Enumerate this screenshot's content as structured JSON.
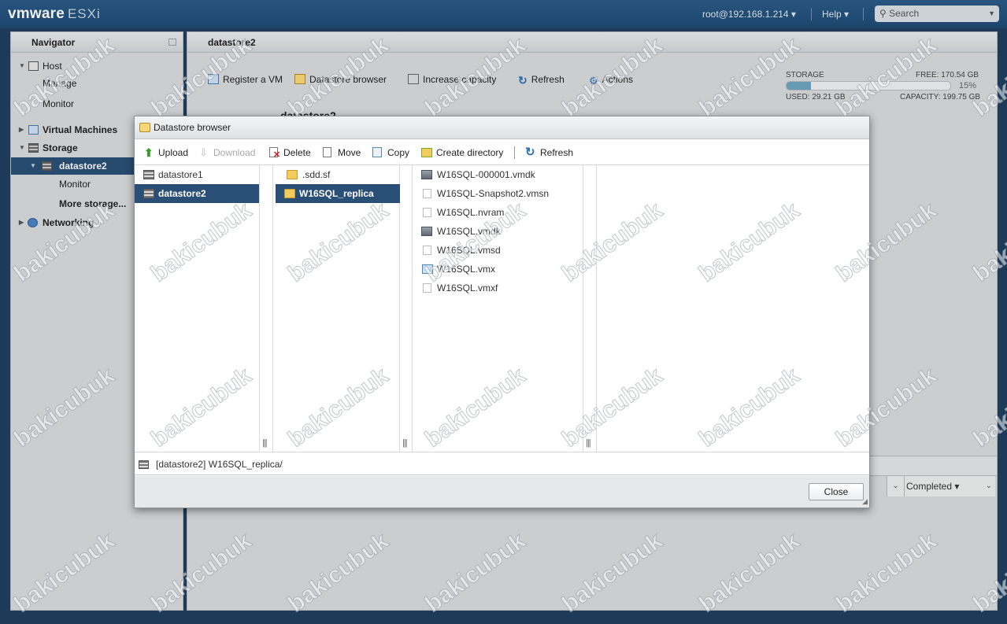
{
  "topbar": {
    "logo_brand": "vmware",
    "logo_product": "ESXi",
    "user": "root@192.168.1.214 ▾",
    "help": "Help ▾",
    "search_placeholder": "Search",
    "search_caret": "▼"
  },
  "navigator": {
    "title": "Navigator",
    "items": [
      {
        "label": "Host",
        "tri": "▼"
      },
      {
        "label": "Manage"
      },
      {
        "label": "Monitor"
      },
      {
        "label": "Virtual Machines",
        "tri": "▶"
      },
      {
        "label": "Storage",
        "tri": "▼"
      },
      {
        "label": "datastore2",
        "tri": "▼"
      },
      {
        "label": "Monitor"
      },
      {
        "label": "More storage..."
      },
      {
        "label": "Networking",
        "tri": "▶"
      }
    ]
  },
  "main": {
    "title": "datastore2",
    "toolbar": {
      "register_vm": "Register a VM",
      "datastore_browser": "Datastore browser",
      "increase_capacity": "Increase capacity",
      "refresh": "Refresh",
      "actions": "Actions"
    },
    "storage": {
      "label": "STORAGE",
      "free": "FREE: 170.54 GB",
      "percent": "15%",
      "used_fraction": 0.15,
      "used": "USED: 29.21 GB",
      "capacity": "CAPACITY: 199.75 GB"
    },
    "heading": "datastore2",
    "tasks_filter": "Completed ▾",
    "tasks_chevron": "⌄"
  },
  "dialog": {
    "title": "Datastore browser",
    "toolbar": {
      "upload": "Upload",
      "download": "Download",
      "delete": "Delete",
      "move": "Move",
      "copy": "Copy",
      "create_directory": "Create directory",
      "refresh": "Refresh"
    },
    "datastores": [
      "datastore1",
      "datastore2"
    ],
    "folders": [
      ".sdd.sf",
      "W16SQL_replica"
    ],
    "files": [
      {
        "name": "W16SQL-000001.vmdk",
        "icon": "disk-icon"
      },
      {
        "name": "W16SQL-Snapshot2.vmsn",
        "icon": "file-icon"
      },
      {
        "name": "W16SQL.nvram",
        "icon": "file-icon"
      },
      {
        "name": "W16SQL.vmdk",
        "icon": "disk-icon"
      },
      {
        "name": "W16SQL.vmsd",
        "icon": "file-icon"
      },
      {
        "name": "W16SQL.vmx",
        "icon": "vmx-icon"
      },
      {
        "name": "W16SQL.vmxf",
        "icon": "file-icon"
      }
    ],
    "grip": "|||",
    "path": "[datastore2] W16SQL_replica/",
    "close": "Close",
    "resize_glyph": "◢"
  },
  "watermark": "bakicubuk",
  "colors": {
    "topbar": "#1e4a73",
    "selection": "#2a4f76",
    "storage_fill": "#6ea5bf"
  }
}
